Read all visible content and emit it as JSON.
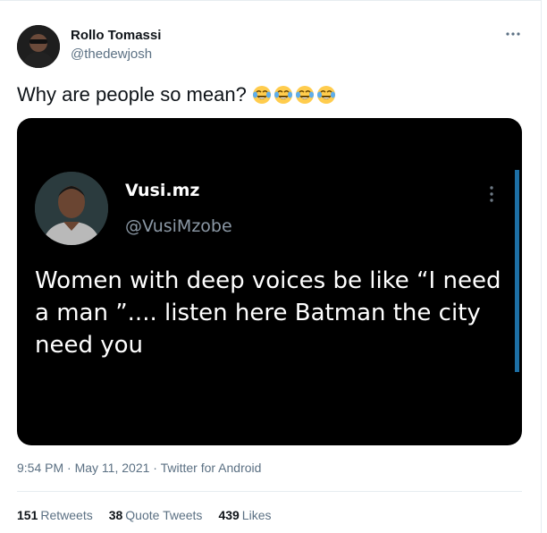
{
  "author": {
    "name": "Rollo Tomassi",
    "handle": "@thedewjosh"
  },
  "tweet": {
    "text": "Why are people so mean?",
    "emoji_icon": "face-with-tears-of-joy-icon",
    "emoji_count": 4
  },
  "media": {
    "quoted_author": {
      "name": "Vusi.mz",
      "handle": "@VusiMzobe"
    },
    "text": "Women with deep voices be like “I need a man ”.... listen here Batman the city need you"
  },
  "meta": {
    "time": "9:54 PM",
    "date": "May 11, 2021",
    "source": "Twitter for Android",
    "separator": "·"
  },
  "stats": {
    "retweets_count": "151",
    "retweets_label": "Retweets",
    "quotes_count": "38",
    "quotes_label": "Quote Tweets",
    "likes_count": "439",
    "likes_label": "Likes"
  },
  "colors": {
    "secondary_text": "#5b7083",
    "media_background": "#000000",
    "divider": "#e6ecf0",
    "scroll_indicator": "#1d6fa5"
  }
}
